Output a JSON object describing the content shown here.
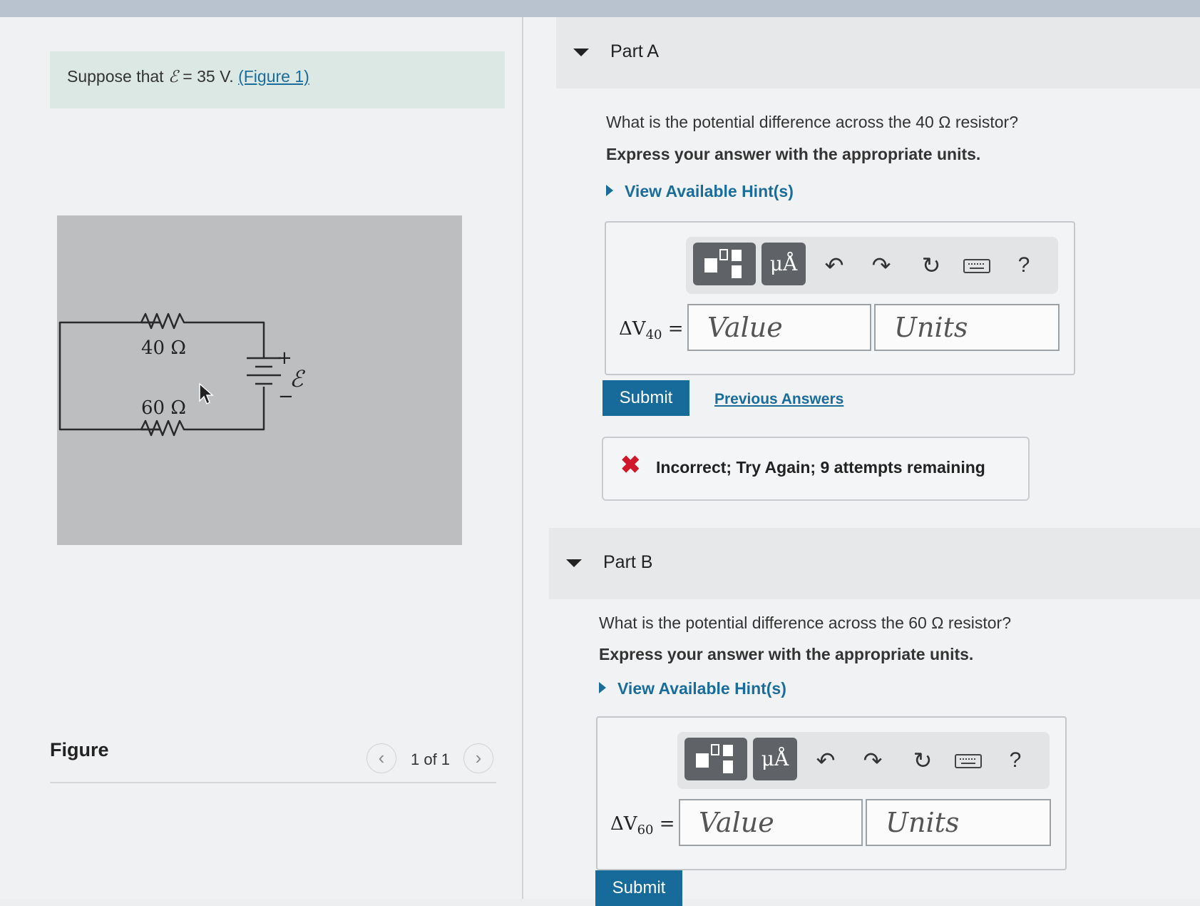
{
  "intro": {
    "prefix": "Suppose that ",
    "emf_symbol": "ℰ",
    "equation": " = 35 V. ",
    "figure_link": "(Figure 1)"
  },
  "circuit": {
    "resistor_top": "40 Ω",
    "resistor_bottom": "60 Ω",
    "emf": "ℰ",
    "plus": "+",
    "minus": "−"
  },
  "figure": {
    "label": "Figure",
    "pager": "1 of 1",
    "prev_icon": "chevron-left-icon",
    "next_icon": "chevron-right-icon"
  },
  "toolbar": {
    "units_button": "μÅ",
    "help": "?",
    "icons": [
      "templates-icon",
      "units-icon",
      "undo-icon",
      "redo-icon",
      "reset-icon",
      "keyboard-icon",
      "help-icon"
    ]
  },
  "part_a": {
    "title": "Part A",
    "question": "What is the potential difference across the 40 Ω resistor?",
    "instruction": "Express your answer with the appropriate units.",
    "hint": "View Available Hint(s)",
    "label_delta": "ΔV",
    "label_sub": "40",
    "label_eq": " =",
    "value_placeholder": "Value",
    "units_placeholder": "Units",
    "submit": "Submit",
    "previous_answers": "Previous Answers",
    "feedback": "Incorrect; Try Again; 9 attempts remaining",
    "feedback_icon": "✖"
  },
  "part_b": {
    "title": "Part B",
    "question": "What is the potential difference across the 60 Ω resistor?",
    "instruction": "Express your answer with the appropriate units.",
    "hint": "View Available Hint(s)",
    "label_delta": "ΔV",
    "label_sub": "60",
    "label_eq": " =",
    "value_placeholder": "Value",
    "units_placeholder": "Units",
    "submit": "Submit"
  },
  "colors": {
    "accent": "#176b9a",
    "error": "#d0162b",
    "intro_bg": "#dbe8e3"
  }
}
